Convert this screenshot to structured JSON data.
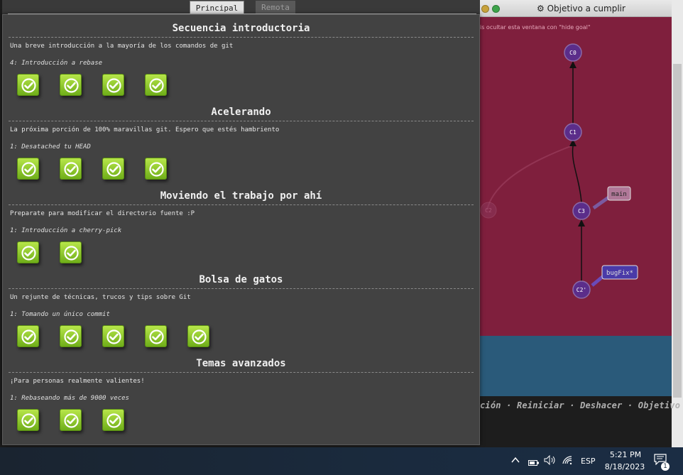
{
  "goal_window": {
    "title": "⚙ Objetivo a cumplir",
    "hint": "is ocultar esta ventana con \"hide goal\"",
    "commits": [
      "C0",
      "C1",
      "C3",
      "C2'",
      "C2"
    ],
    "branches": [
      "main",
      "bugFix*"
    ]
  },
  "command_bar": {
    "text": "ción · Reiniciar · Deshacer · Objetivo ·"
  },
  "tabs": {
    "principal": "Principal",
    "remota": "Remota"
  },
  "sequences": [
    {
      "title": "Secuencia introductoria",
      "description": "Una breve introducción a la mayoría de los comandos de git",
      "current_level": "4: Introducción a rebase",
      "levels": [
        {
          "state": "completed"
        },
        {
          "state": "completed"
        },
        {
          "state": "completed"
        },
        {
          "state": "completed"
        }
      ]
    },
    {
      "title": "Acelerando",
      "description": "La próxima porción de 100% maravillas git. Espero que estés hambriento",
      "current_level": "1: Desatached tu HEAD",
      "levels": [
        {
          "state": "completed"
        },
        {
          "state": "completed"
        },
        {
          "state": "completed"
        },
        {
          "state": "completed"
        }
      ]
    },
    {
      "title": "Moviendo el trabajo por ahí",
      "description": "Preparate para modificar el directorio fuente :P",
      "current_level": "1: Introducción a cherry-pick",
      "levels": [
        {
          "state": "completed"
        },
        {
          "state": "completed"
        }
      ]
    },
    {
      "title": "Bolsa de gatos",
      "description": "Un rejunte de técnicas, trucos y tips sobre Git",
      "current_level": "1: Tomando un único commit",
      "levels": [
        {
          "state": "completed"
        },
        {
          "state": "completed"
        },
        {
          "state": "completed"
        },
        {
          "state": "completed"
        },
        {
          "state": "completed"
        }
      ]
    },
    {
      "title": "Temas avanzados",
      "description": "¡Para personas realmente valientes!",
      "current_level": "1: Rebaseando más de 9000 veces",
      "levels": [
        {
          "state": "completed"
        },
        {
          "state": "completed"
        },
        {
          "state": "completed"
        }
      ]
    }
  ],
  "taskbar": {
    "language": "ESP",
    "time": "5:21 PM",
    "date": "8/18/2023",
    "notifications": "1"
  },
  "colors": {
    "goal_bg": "#7f1f3d",
    "panel_bg": "#424242",
    "commit_fill": "#5b2d8a",
    "level_done": "#8bc62a"
  }
}
